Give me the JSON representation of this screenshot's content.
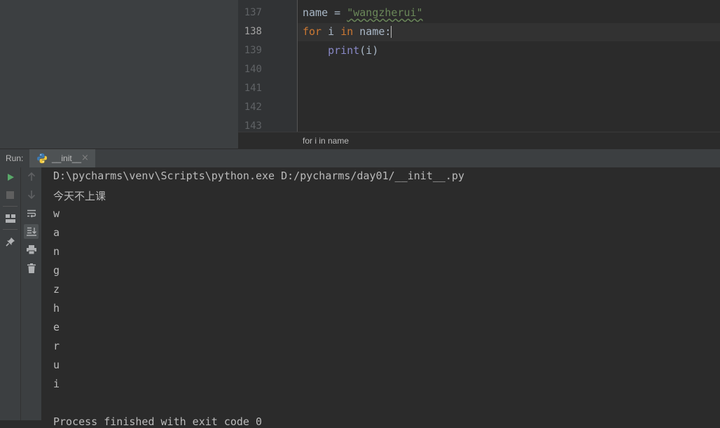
{
  "editor": {
    "lines": [
      {
        "num": "137",
        "current": false,
        "tokens": [
          {
            "text": "name = ",
            "cls": ""
          },
          {
            "text": "\"wangzherui\"",
            "cls": "str squig"
          }
        ]
      },
      {
        "num": "138",
        "current": true,
        "tokens": [
          {
            "text": "for",
            "cls": "kw"
          },
          {
            "text": " i ",
            "cls": ""
          },
          {
            "text": "in",
            "cls": "kw"
          },
          {
            "text": " name:",
            "cls": ""
          }
        ]
      },
      {
        "num": "139",
        "current": false,
        "tokens": [
          {
            "text": "    ",
            "cls": ""
          },
          {
            "text": "print",
            "cls": "builtin"
          },
          {
            "text": "(i)",
            "cls": ""
          }
        ]
      },
      {
        "num": "140",
        "current": false,
        "tokens": []
      },
      {
        "num": "141",
        "current": false,
        "tokens": []
      },
      {
        "num": "142",
        "current": false,
        "tokens": []
      },
      {
        "num": "143",
        "current": false,
        "tokens": []
      }
    ],
    "breadcrumb": "for i in name"
  },
  "run_panel": {
    "label": "Run:",
    "tab_label": "__init__",
    "tab_close": "×",
    "tab_icon": "python-icon",
    "toolbar_icons": {
      "left": [
        "run-icon",
        "stop-icon",
        "layout-icon",
        "pin-icon"
      ],
      "right": [
        "up-arrow-icon",
        "down-arrow-icon",
        "soft-wrap-icon",
        "scroll-to-end-icon",
        "print-icon",
        "trash-icon"
      ]
    }
  },
  "console": {
    "lines": [
      "D:\\pycharms\\venv\\Scripts\\python.exe D:/pycharms/day01/__init__.py",
      "今天不上课",
      "w",
      "a",
      "n",
      "g",
      "z",
      "h",
      "e",
      "r",
      "u",
      "i",
      "",
      "Process finished with exit code 0"
    ]
  },
  "colors": {
    "keyword": "#cc7832",
    "string": "#6a8759",
    "builtin": "#8888c6",
    "run_green": "#59a869"
  }
}
